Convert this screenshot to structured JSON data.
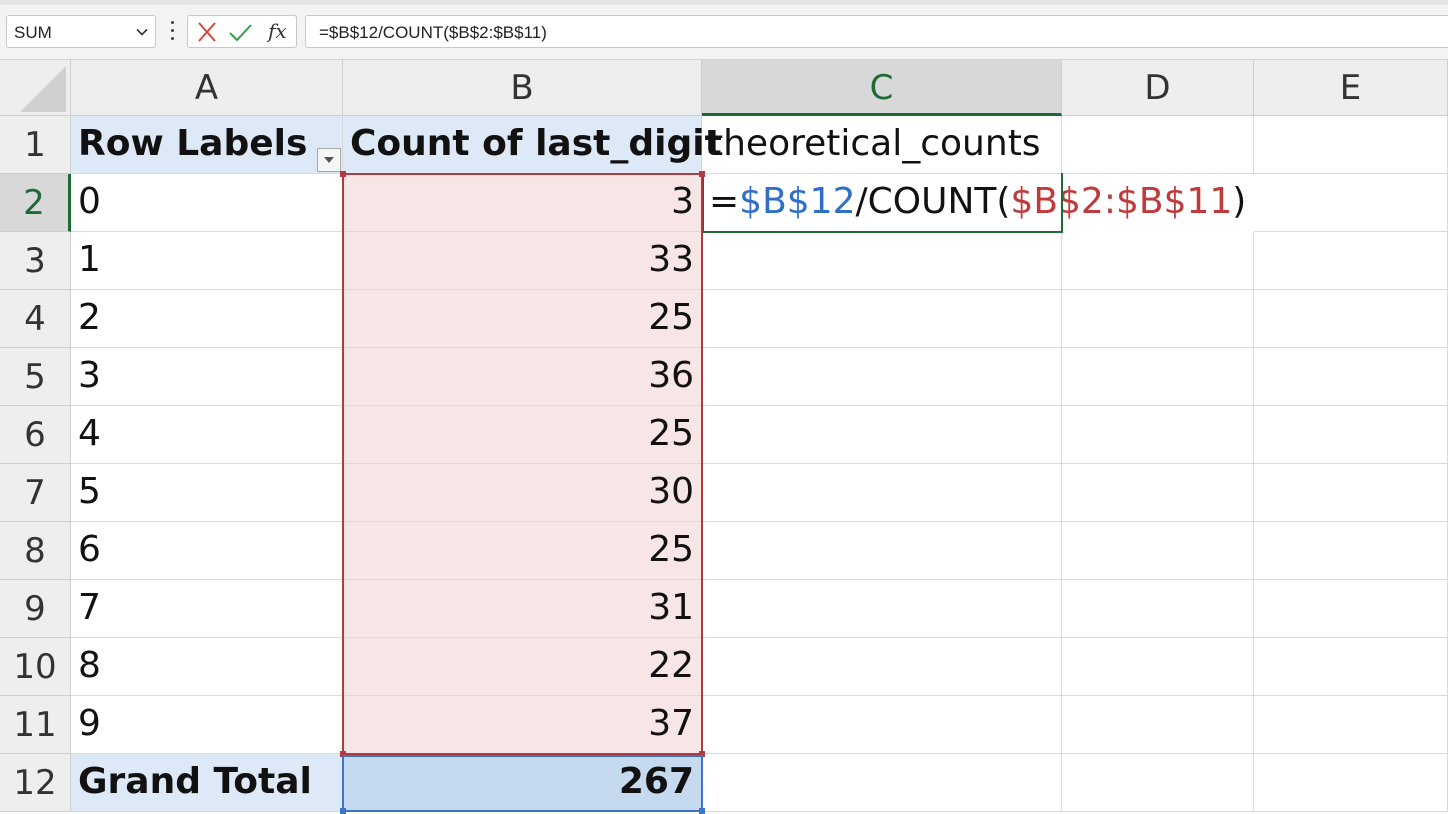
{
  "formula_bar": {
    "name_box": "SUM",
    "cancel_icon": "x-icon",
    "enter_icon": "check-icon",
    "fx_label": "fx",
    "formula": "=$B$12/COUNT($B$2:$B$11)"
  },
  "columns": [
    "A",
    "B",
    "C",
    "D",
    "E"
  ],
  "rows": [
    "1",
    "2",
    "3",
    "4",
    "5",
    "6",
    "7",
    "8",
    "9",
    "10",
    "11",
    "12"
  ],
  "active_column": "C",
  "active_row": "2",
  "pivot": {
    "header_row_labels": "Row Labels",
    "header_count": "Count of last_digit",
    "labels": [
      "0",
      "1",
      "2",
      "3",
      "4",
      "5",
      "6",
      "7",
      "8",
      "9"
    ],
    "counts": [
      "3",
      "33",
      "25",
      "36",
      "25",
      "30",
      "25",
      "31",
      "22",
      "37"
    ],
    "grand_total_label": "Grand Total",
    "grand_total_value": "267"
  },
  "c1_text": "theoretical_counts",
  "c2_formula": {
    "prefix": "=",
    "ref1": "$B$12",
    "mid": "/COUNT(",
    "ref2": "$B$2:$B$11",
    "suffix": ")"
  },
  "colors": {
    "active_green": "#1e6a36",
    "ref_blue": "#2f6fc8",
    "ref_red": "#c0393b",
    "pivot_header_blue": "#dde9f6",
    "range_pink": "#f8e6e6"
  }
}
